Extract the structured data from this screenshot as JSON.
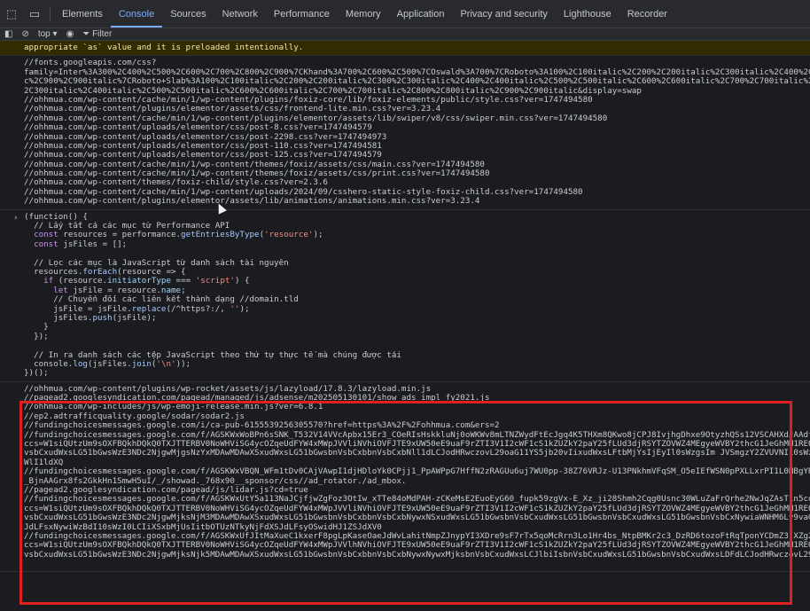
{
  "tabs": [
    "Elements",
    "Console",
    "Sources",
    "Network",
    "Performance",
    "Memory",
    "Application",
    "Privacy and security",
    "Lighthouse",
    "Recorder"
  ],
  "active_tab": "Console",
  "toolbar": {
    "context": "top",
    "filter_placeholder": "Filter"
  },
  "warning_tail": "appropriate `as` value and it is preloaded intentionally.",
  "css_links": [
    "//fonts.googleapis.com/css?",
    "family=Inter%3A300%2C400%2C500%2C600%2C700%2C800%2C900%7CKhand%3A700%2C600%2C500%7COswald%3A700%7CRoboto%3A100%2C100italic%2C200%2C200italic%2C300italic%2C400%2C400italic%2C500%2C500italic%2C600%2C600italic%2C700%2C700italic%2C800%2C800italic%2C900%2C900italic%7CRoboto+Slab%3A100%2C200%2C200italic%2C300%2C300italic%2C400%2C400italic%2C500%2C500italic%2C600%2C600italic%2C700%2C700italic%2C800%2C",
    "c%2C900%2C900italic%7CRoboto+Slab%3A100%2C100italic%2C200%2C200italic%2C300%2C300italic%2C400%2C400italic%2C500%2C500italic%2C600%2C600italic%2C700%2C700italic%2C800%2C8",
    "2C300italic%2C400italic%2C500%2C500italic%2C600%2C600italic%2C700%2C700italic%2C800%2C800italic%2C900%2C900italic&display=swap",
    "//ohhmua.com/wp-content/cache/min/1/wp-content/plugins/foxiz-core/lib/foxiz-elements/public/style.css?ver=1747494580",
    "//ohhmua.com/wp-content/plugins/elementor/assets/css/frontend-lite.min.css?ver=3.23.4",
    "//ohhmua.com/wp-content/cache/min/1/wp-content/plugins/elementor/assets/lib/swiper/v8/css/swiper.min.css?ver=1747494580",
    "//ohhmua.com/wp-content/uploads/elementor/css/post-8.css?ver=1747494579",
    "//ohhmua.com/wp-content/uploads/elementor/css/post-2298.css?ver=1747494973",
    "//ohhmua.com/wp-content/uploads/elementor/css/post-110.css?ver=1747494581",
    "//ohhmua.com/wp-content/uploads/elementor/css/post-125.css?ver=1747494579",
    "//ohhmua.com/wp-content/cache/min/1/wp-content/themes/foxiz/assets/css/main.css?ver=1747494580",
    "//ohhmua.com/wp-content/cache/min/1/wp-content/themes/foxiz/assets/css/print.css?ver=1747494580",
    "//ohhmua.com/wp-content/themes/foxiz-child/style.css?ver=2.3.6",
    "//ohhmua.com/wp-content/cache/min/1/wp-content/uploads/2024/09/csshero-static-style-foxiz-child.css?ver=1747494580",
    "//ohhmua.com/wp-content/plugins/elementor/assets/lib/animations/animations.min.css?ver=3.23.4"
  ],
  "code": {
    "l1": "(function() {",
    "c1": "  // Lấy tất cả các mục từ Performance API",
    "l2a": "  ",
    "l2k": "const",
    "l2b": " resources = performance.",
    "l2f": "getEntriesByType",
    "l2c": "(",
    "l2s": "'resource'",
    "l2d": ");",
    "l3k": "const",
    "l3b": " jsFiles = [];",
    "c2": "  // Lọc các mục là JavaScript từ danh sách tài nguyên",
    "l4a": "  resources.",
    "l4f": "forEach",
    "l4b": "(resource => {",
    "l5a": "    ",
    "l5k": "if",
    "l5b": " (resource.",
    "l5p": "initiatorType",
    "l5c": " === ",
    "l5s": "'script'",
    "l5d": ") {",
    "l6a": "      ",
    "l6k": "let",
    "l6b": " jsFile = resource.",
    "l6p": "name",
    "l6c": ";",
    "c3": "      // Chuyển đổi các liên kết thành dạng //domain.tld",
    "l7a": "      jsFile = jsFile.",
    "l7f": "replace",
    "l7b": "(/^https?:/, ",
    "l7s": "''",
    "l7c": ");",
    "l8a": "      jsFiles.",
    "l8f": "push",
    "l8b": "(jsFile);",
    "l9": "    }",
    "l10": "  });",
    "c4": "  // In ra danh sách các tệp JavaScript theo thứ tự thực tế mà chúng được tải",
    "l11a": "  console.",
    "l11f": "log",
    "l11b": "(jsFiles.",
    "l11g": "join",
    "l11c": "(",
    "l11s": "'\\n'",
    "l11d": "));",
    "l12": "})();"
  },
  "js_output": [
    "//ohhmua.com/wp-content/plugins/wp-rocket/assets/js/lazyload/17.8.3/lazyload.min.js",
    "//pagead2.googlesyndication.com/pagead/managed/js/adsense/m202505130101/show_ads_impl_fy2021.js",
    "//ohhmua.com/wp-includes/js/wp-emoji-release.min.js?ver=6.8.1",
    "//ep2.adtrafficquality.google/sodar/sodar2.js",
    "//fundingchoicesmessages.google.com/i/ca-pub-6155539256305570?href=https%3A%2F%2Fohhmua.com&ers=2",
    "//fundingchoicesmessages.google.com/f/AGSKWxWoBPn6sSNK_T532V14VVcApbx15Er3_COeRIsHskkluNj0oWKWv8mLTNZWydFtEcJgq4K5THXm8QKwo8jCPJ8IvjhgDhxe9OtyzhQSs12VSCAHXdJAAdf76Ga0_-4",
    "ccs=W1siQUtzUm9sOXFBQkhDQkQ0TXJTTERBV0NoWHViSG4ycOZqeUdFYW4xMWpJVVliNVhiOVFJTE9xUW50eE9uaF9rZTI3V1I2cWF1cS1kZUZkY2paY25fLUd3djRSYTZOVWZ4MEgyeWVBY2thcG1JeGhMN1REQTVIe1f",
    "vsbCxudWxsLG51bGwsWzE3NDc2NjgwMjgsNzYxMDAwMDAwXSxudWxsLG51bGwsbnVsbCxbbnVsbCxbNll1dLCJodHRwczovL29oaG11YS5jb20vIixudWxsLFtbMjYsIjEyIl0sWzgsIm JVSmgzY2ZVUVNI10sWzksImVuVVV",
    "WlI1ldXQ",
    "//fundingchoicesmessages.google.com/f/AGSKWxVBQN_WFm1tDv0CAjVAwpI1djHDloYk0CPjj1_PpAWPpG7HffN2zRAGUu6uj7WU0pp-38Z76VRJz-U13PNkhmVFqSM_O5eIEfWSN0pPXLLxrPI1L0HBgYRm6lgY1K",
    "_BjnAAGrx8fs2GkkHn1SmwH5uI/_/showad._768x90__sponsor/css//ad_rotator./ad_mbox.",
    "//pagead2.googlesyndication.com/pagead/js/lidar.js?cd=true",
    "//fundingchoicesmessages.google.com/f/AGSKWxUtY5a113NaJCjfjwZgFoz3OtIw_xTTe84oMdPAH-zCKeMsE2EuoEyG60_fupk59zgVx-E_Xz_ji28Shmh2Cqg0Usnc30WLuZaFrQrhe2NwJqZAsT1n5coJIVFAn6",
    "ccs=W1siQUtzUm9sOXFBQkhDQkQ0TXJTTERBV0NoWHViSG4ycOZqeUdFYW4xMWpJVVliNVhiOVFJTE9xUW50eE9uaF9rZTI3V1I2cWF1cS1kZUZkY2paY25fLUd3djRSYTZOVWZ4MEgyeWVBY2thcG1JeGhMN1REQTVIe1f",
    "vsbCxudWxsLG51bGwsWzE3NDc2NjgwMjksNjM3MDAwMDAwXSxudWxsLG51bGwsbnVsbCxbbnVsbCxbNywxNSxudWxsLG51bGwsbnVsbCxudWxsLG51bGwsbnVsbCxudWxsLG51bGwsbnVsbCxNywiaWNHM6Ly9vaGtoWE",
    "JdLFsxNywiWzBdI10sWzI0LCIiXSxbMjUsIitbOTUzNTkyNjFdXSJdLFsyOSwidHJ1ZSJdXV0",
    "//fundingchoicesmessages.google.com/f/AGSKWxUfJItMaXueC1kxerF8pgLpKaseOaeJdWvLahitNmpZJnypYI3XDre9sF7rTx5qoMcRrn3Lo1Hr4bs_NtpBMKr2c3_DzRD6tozoFtRqTponYCDmZ3-XZg2siMKM4hw",
    "ccs=W1siQUtzUm9sOXFBQkhDQkQ0TXJTTERBV0NoWHViSG4ycOZqeUdFYW4xMWpJVVlhNVhiOVFJTE9xUW50eE9uaF9rZTI3V1I2cWF1cS1kZUZkY2paY25fLUd3djRSYTZOVWZ4MEgyeWVBY2thcG1JeGhMN1REQTVIe1f",
    "vsbCxudWxsLG51bGwsWzE3NDc2NjgwMjksNjk5MDAwMDAwXSxudWxsLG51bGwsbnVsbCxbbnVsbCxbNywxNywxMjksbnVsbCxudWxsLCJlbiIsbnVsbCxudWxsLG51bGwsbnVsbCxudWxsLDFdLCJodHRwczovL29oaG11Y"
  ]
}
